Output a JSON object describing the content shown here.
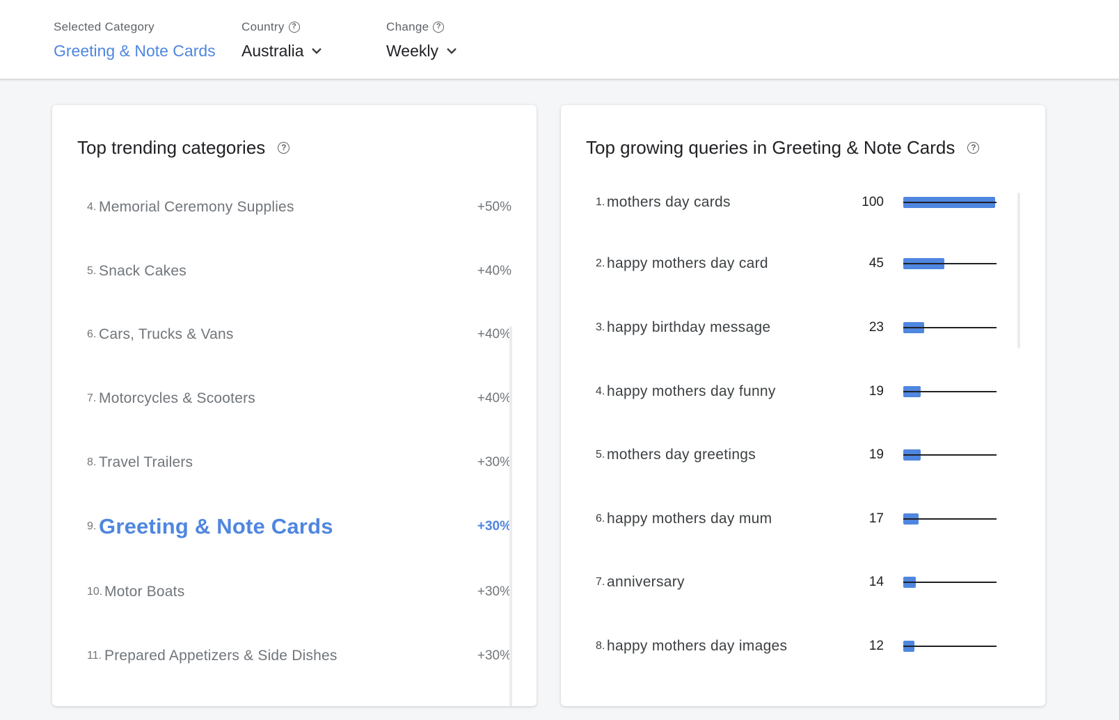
{
  "header": {
    "selected_category": {
      "label": "Selected Category",
      "value": "Greeting & Note Cards"
    },
    "country": {
      "label": "Country",
      "value": "Australia"
    },
    "change": {
      "label": "Change",
      "value": "Weekly"
    }
  },
  "left_card": {
    "title": "Top trending categories",
    "items": [
      {
        "rank": "4.",
        "name": "Memorial Ceremony Supplies",
        "change": "+50%"
      },
      {
        "rank": "5.",
        "name": "Snack Cakes",
        "change": "+40%"
      },
      {
        "rank": "6.",
        "name": "Cars, Trucks & Vans",
        "change": "+40%"
      },
      {
        "rank": "7.",
        "name": "Motorcycles & Scooters",
        "change": "+40%"
      },
      {
        "rank": "8.",
        "name": "Travel Trailers",
        "change": "+30%"
      },
      {
        "rank": "9.",
        "name": "Greeting & Note Cards",
        "change": "+30%",
        "active": true
      },
      {
        "rank": "10.",
        "name": "Motor Boats",
        "change": "+30%"
      },
      {
        "rank": "11.",
        "name": "Prepared Appetizers & Side Dishes",
        "change": "+30%"
      }
    ]
  },
  "right_card": {
    "title": "Top growing queries in Greeting & Note Cards",
    "items": [
      {
        "rank": "1.",
        "query": "mothers day cards",
        "score": 100
      },
      {
        "rank": "2.",
        "query": "happy mothers day card",
        "score": 45
      },
      {
        "rank": "3.",
        "query": "happy birthday message",
        "score": 23
      },
      {
        "rank": "4.",
        "query": "happy mothers day funny",
        "score": 19
      },
      {
        "rank": "5.",
        "query": "mothers day greetings",
        "score": 19
      },
      {
        "rank": "6.",
        "query": "happy mothers day mum",
        "score": 17
      },
      {
        "rank": "7.",
        "query": "anniversary",
        "score": 14
      },
      {
        "rank": "8.",
        "query": "happy mothers day images",
        "score": 12
      }
    ]
  },
  "colors": {
    "accent": "#4f86e0",
    "bar": "#4f86e0"
  },
  "icons": {
    "help": "help-circle-icon",
    "dropdown": "chevron-down-icon"
  }
}
